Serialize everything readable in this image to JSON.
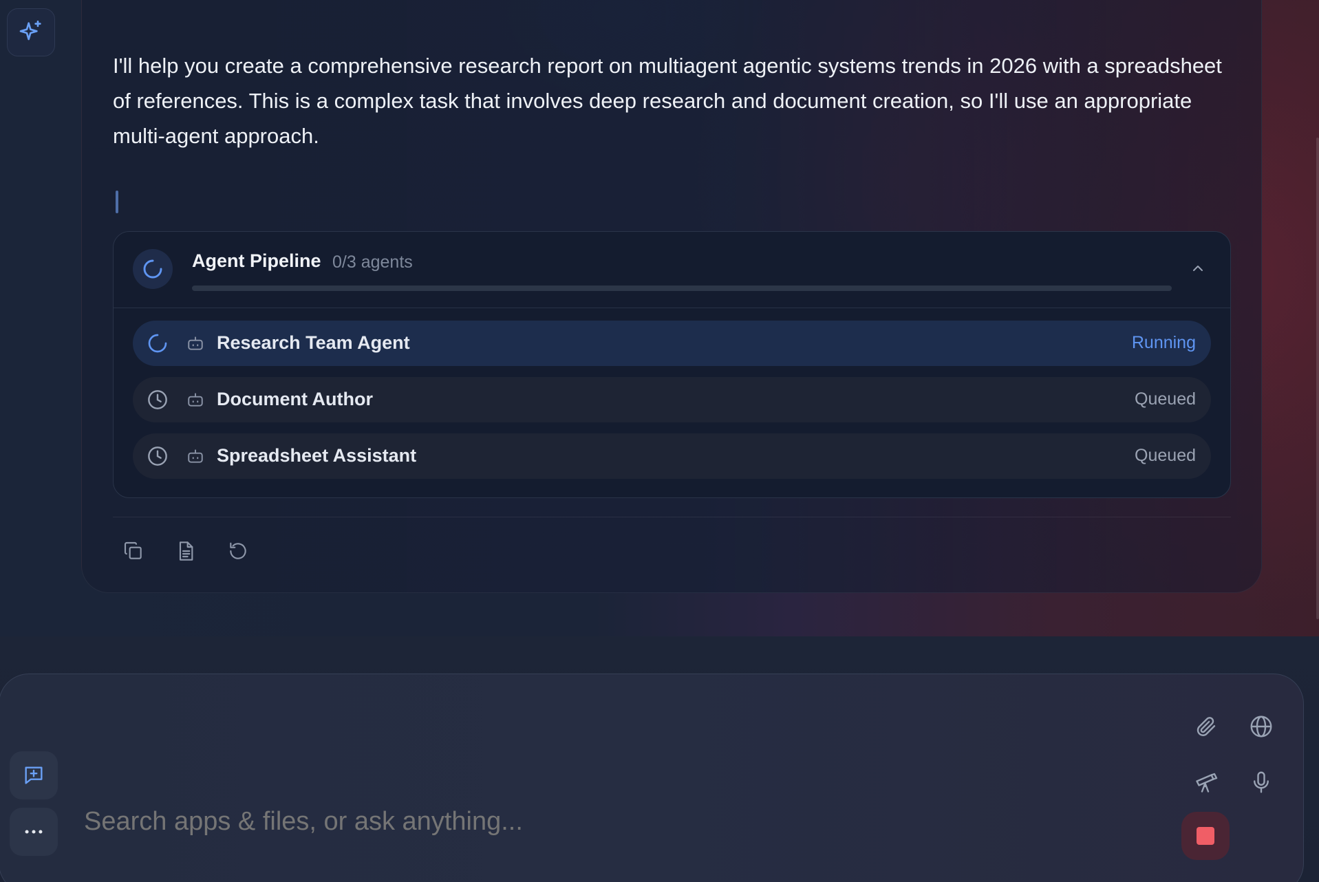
{
  "assistant_message": {
    "text": "I'll help you create a comprehensive research report on multiagent agentic systems trends in 2026 with a spreadsheet of references. This is a complex task that involves deep research and document creation, so I'll use an appropriate multi-agent approach."
  },
  "pipeline": {
    "title": "Agent Pipeline",
    "count": "0/3 agents",
    "progress": 0.0,
    "agents": [
      {
        "name": "Research Team Agent",
        "status": "Running"
      },
      {
        "name": "Document Author",
        "status": "Queued"
      },
      {
        "name": "Spreadsheet Assistant",
        "status": "Queued"
      }
    ]
  },
  "composer": {
    "placeholder": "Search apps & files, or ask anything..."
  },
  "colors": {
    "accent": "#4b82e8",
    "running": "#5f95f2",
    "stop": "#f05e66"
  },
  "icons": {
    "top_left": "sparkle-icon",
    "actions": [
      "copy-icon",
      "document-icon",
      "regenerate-icon"
    ],
    "composer_tools": [
      "paperclip-icon",
      "globe-icon",
      "telescope-icon",
      "microphone-icon"
    ],
    "side": [
      "new-chat-icon",
      "more-icon"
    ]
  }
}
